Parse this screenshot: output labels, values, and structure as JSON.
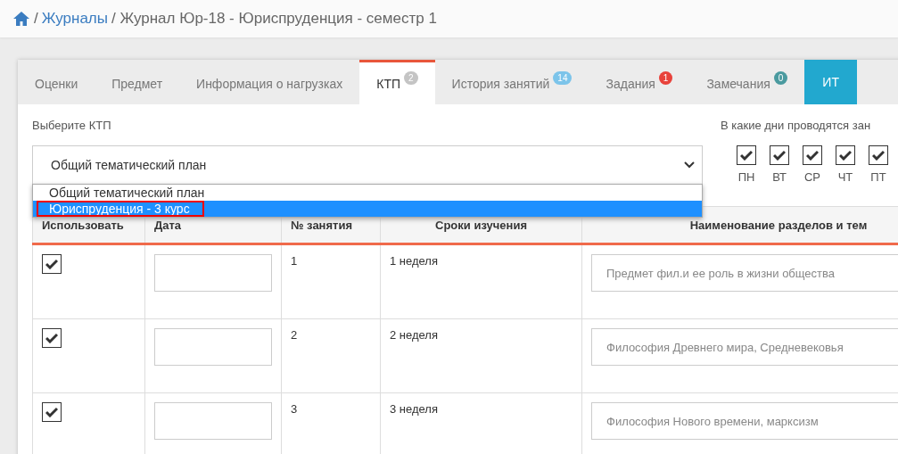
{
  "breadcrumb": {
    "separator": "/",
    "link": "Журналы",
    "current": "/ Журнал Юр-18 - Юриспруденция - семестр 1"
  },
  "tabs": [
    {
      "label": "Оценки",
      "selected": false,
      "kind": "plain"
    },
    {
      "label": "Предмет",
      "selected": false,
      "kind": "plain"
    },
    {
      "label": "Информация о нагрузках",
      "selected": false,
      "kind": "plain"
    },
    {
      "label": "КТП",
      "selected": true,
      "kind": "plain",
      "badge": "2",
      "color": "#c4c4c4"
    },
    {
      "label": "История занятий",
      "selected": false,
      "kind": "plain",
      "badge": "14",
      "color": "#7cc4ea"
    },
    {
      "label": "Задания",
      "selected": false,
      "kind": "plain",
      "badge": "1",
      "color": "#e8423b"
    },
    {
      "label": "Замечания",
      "selected": false,
      "kind": "plain",
      "badge": "0",
      "color": "#4a9a9f"
    },
    {
      "label": "ИТ",
      "selected": false,
      "kind": "button"
    }
  ],
  "ktp": {
    "label": "Выберите КТП",
    "value": "Общий тематический план",
    "options": [
      {
        "label": "Общий тематический план",
        "highlighted": false,
        "outlined": false
      },
      {
        "label": "Юриспруденция - 3 курс",
        "highlighted": true,
        "outlined": true
      }
    ]
  },
  "days": {
    "label": "В какие дни проводятся зан",
    "items": [
      {
        "label": "ПН",
        "checked": true
      },
      {
        "label": "ВТ",
        "checked": true
      },
      {
        "label": "СР",
        "checked": true
      },
      {
        "label": "ЧТ",
        "checked": true
      },
      {
        "label": "ПТ",
        "checked": true
      }
    ]
  },
  "table": {
    "columns": [
      "Использовать",
      "Дата",
      "№ занятия",
      "Сроки изучения",
      "Наименование разделов и тем"
    ],
    "rows": [
      {
        "used": true,
        "number": "1",
        "period": "1 неделя",
        "topic": "Предмет фил.и ее роль в жизни общества"
      },
      {
        "used": true,
        "number": "2",
        "period": "2 неделя",
        "topic": "Философия Древнего мира, Средневековья"
      },
      {
        "used": true,
        "number": "3",
        "period": "3 неделя",
        "topic": "Философия Нового времени, марксизм"
      }
    ]
  }
}
